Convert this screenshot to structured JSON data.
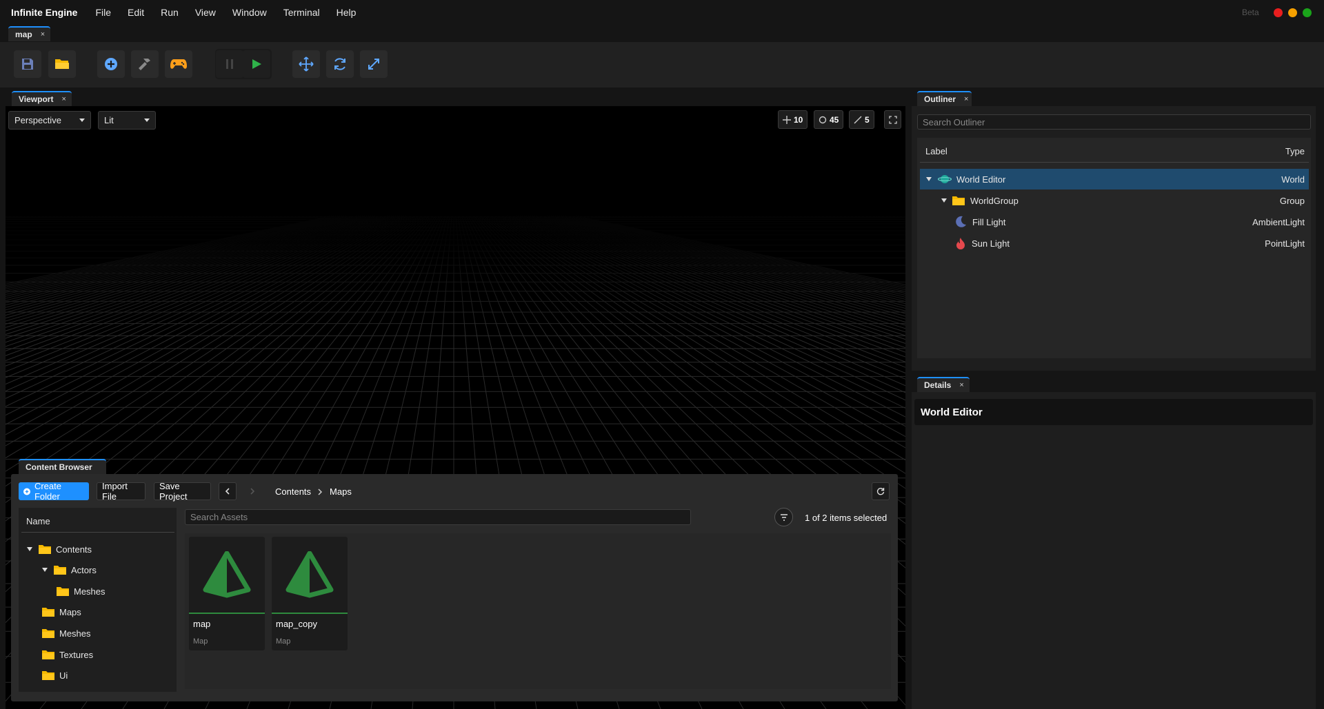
{
  "app": {
    "title": "Infinite Engine",
    "beta": "Beta"
  },
  "menu": [
    "File",
    "Edit",
    "Run",
    "View",
    "Window",
    "Terminal",
    "Help"
  ],
  "doc_tab": {
    "label": "map",
    "close": "×"
  },
  "toolbar": {
    "icons": [
      "save-icon",
      "folder-open-icon",
      "add-icon",
      "hammer-icon",
      "gamepad-icon",
      "pause-icon",
      "play-icon",
      "move-icon",
      "rotate-icon",
      "scale-icon"
    ]
  },
  "viewport": {
    "tab": "Viewport",
    "close": "×",
    "projection": "Perspective",
    "shading": "Lit",
    "snap_move": "10",
    "snap_rotate": "45",
    "snap_scale": "5"
  },
  "outliner": {
    "tab": "Outliner",
    "close": "×",
    "search_placeholder": "Search Outliner",
    "col_label": "Label",
    "col_type": "Type",
    "rows": [
      {
        "label": "World Editor",
        "type": "World"
      },
      {
        "label": "WorldGroup",
        "type": "Group"
      },
      {
        "label": "Fill Light",
        "type": "AmbientLight"
      },
      {
        "label": "Sun Light",
        "type": "PointLight"
      }
    ]
  },
  "details": {
    "tab": "Details",
    "close": "×",
    "title": "World Editor"
  },
  "content_browser": {
    "tab": "Content Browser",
    "create_folder": "Create Folder",
    "import_file": "Import File",
    "save_project": "Save Project",
    "breadcrumb": [
      "Contents",
      "Maps"
    ],
    "search_placeholder": "Search Assets",
    "selection": "1 of 2 items selected",
    "tree_header": "Name",
    "tree": [
      "Contents",
      "Actors",
      "Meshes",
      "Maps",
      "Meshes",
      "Textures",
      "Ui"
    ],
    "assets": [
      {
        "name": "map",
        "type": "Map"
      },
      {
        "name": "map_copy",
        "type": "Map"
      }
    ]
  },
  "colors": {
    "accent": "#1e90ff",
    "selection": "#1f4b6e",
    "folder": "#f5b800",
    "map_icon": "#2e8b3e"
  }
}
